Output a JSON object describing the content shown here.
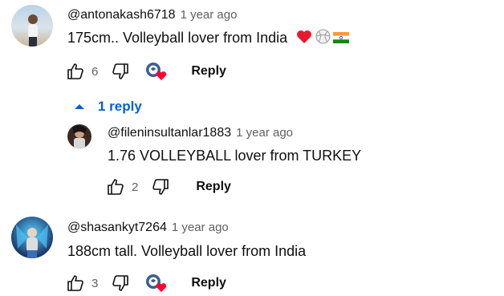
{
  "comments": [
    {
      "author": "@antonakash6718",
      "time": "1 year ago",
      "text": "175cm.. Volleyball lover from India",
      "likes": "6",
      "reply_label": "Reply"
    },
    {
      "author": "@shasankyt7264",
      "time": "1 year ago",
      "text": "188cm tall. Volleyball lover from India",
      "likes": "3",
      "reply_label": "Reply"
    }
  ],
  "replies_toggle": {
    "label": "1 reply",
    "icon": "chevron-up-icon"
  },
  "reply": {
    "author": "@fileninsultanlar1883",
    "time": "1 year ago",
    "text": "1.76 VOLLEYBALL lover from TURKEY",
    "likes": "2",
    "reply_label": "Reply"
  },
  "colors": {
    "link_blue": "#065fd4",
    "heart_red": "#ff0033",
    "muted": "#606060"
  },
  "icons": [
    "thumbs-up-icon",
    "thumbs-down-icon",
    "creator-heart-icon",
    "red-heart-emoji",
    "volleyball-emoji",
    "india-flag-emoji"
  ]
}
